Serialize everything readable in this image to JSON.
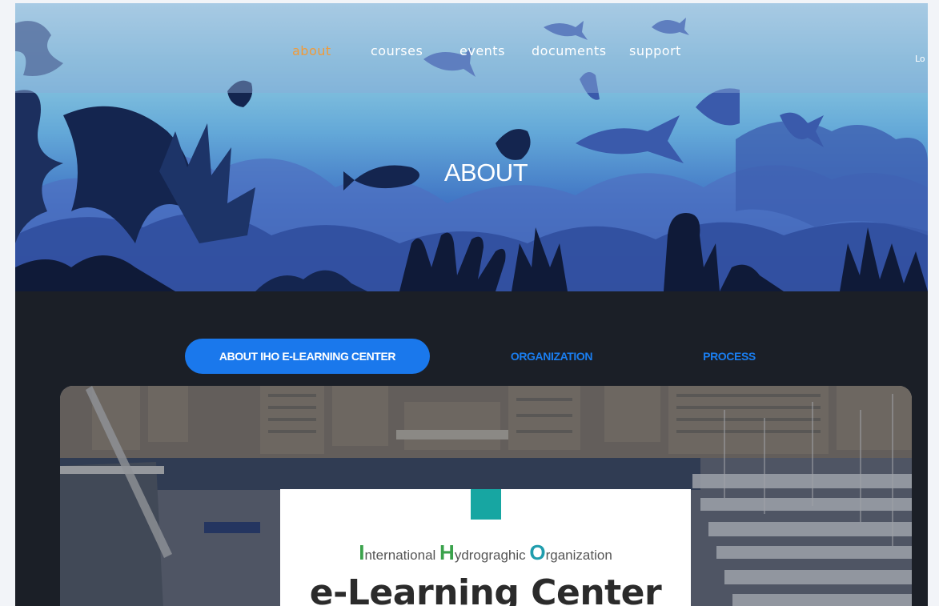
{
  "header": {
    "nav_items": [
      {
        "label": "about",
        "active": true
      },
      {
        "label": "courses",
        "active": false
      },
      {
        "label": "events",
        "active": false
      },
      {
        "label": "documents",
        "active": false
      },
      {
        "label": "support",
        "active": false
      }
    ],
    "login_label": "Lo",
    "active_color": "#f29a37"
  },
  "hero": {
    "title": "ABOUT"
  },
  "tabs": [
    {
      "label": "ABOUT IHO E-LEARNING CENTER",
      "active": true
    },
    {
      "label": "ORGANIZATION",
      "active": false
    },
    {
      "label": "PROCESS",
      "active": false
    }
  ],
  "card": {
    "org_initial_1": "I",
    "org_word_1": "nternational ",
    "org_initial_2": "H",
    "org_word_2": "ydrograghic ",
    "org_initial_3": "O",
    "org_word_3": "rganization",
    "center_title": "e-Learning Center",
    "accent_color": "#17a6a2"
  },
  "colors": {
    "tab_active": "#1a78ec",
    "tab_text": "#1a7ef0",
    "section_bg": "#1b1f27"
  }
}
